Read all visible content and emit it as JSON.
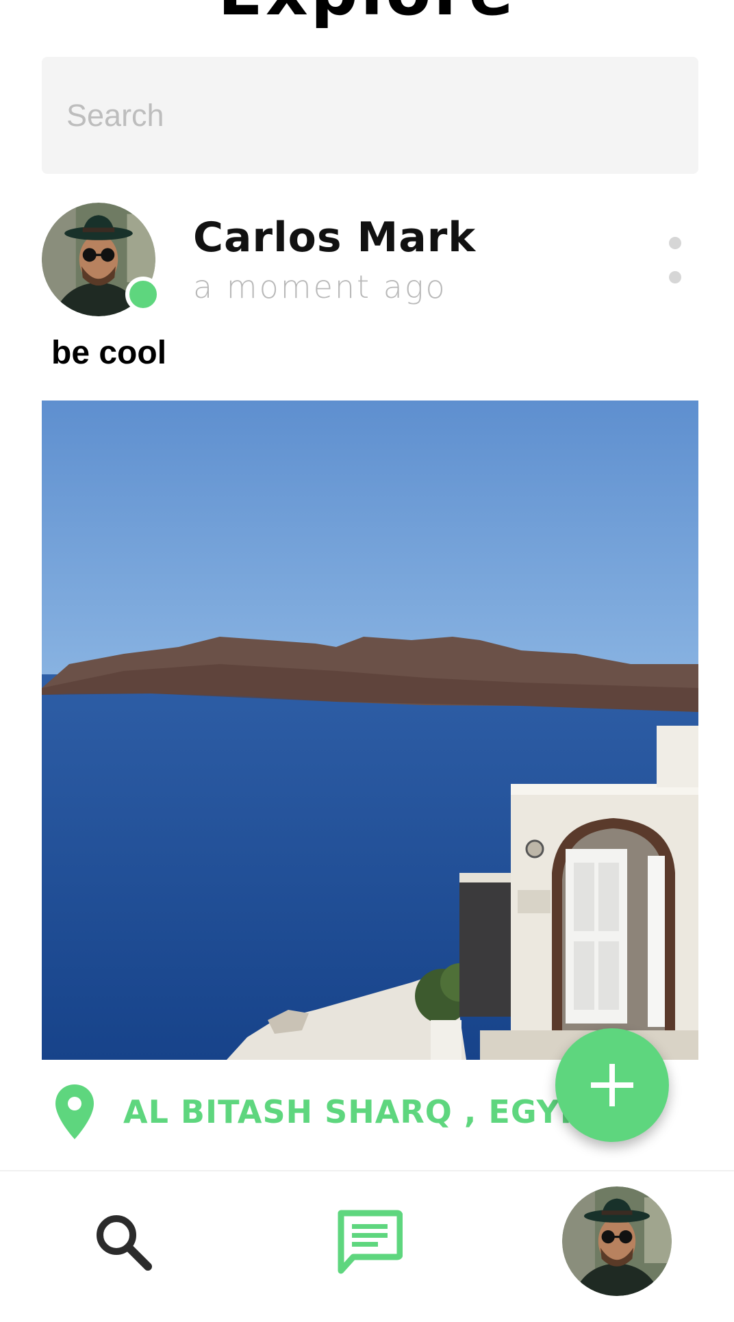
{
  "header": {
    "title": "Explore"
  },
  "search": {
    "placeholder": "Search"
  },
  "post": {
    "author_name": "Carlos Mark",
    "time": "a moment ago",
    "caption": "be cool",
    "location": "AL BITASH SHARQ , EGYPT",
    "online": true
  },
  "icons": {
    "more": "more-vertical-icon",
    "location": "location-pin-icon",
    "add": "plus-icon",
    "nav_search": "search-icon",
    "nav_chat": "chat-icon"
  },
  "colors": {
    "accent": "#5ed67e",
    "search_bg": "#f4f4f4",
    "muted_text": "#b8b8b8",
    "nav_icon_dark": "#2b2b2b"
  }
}
